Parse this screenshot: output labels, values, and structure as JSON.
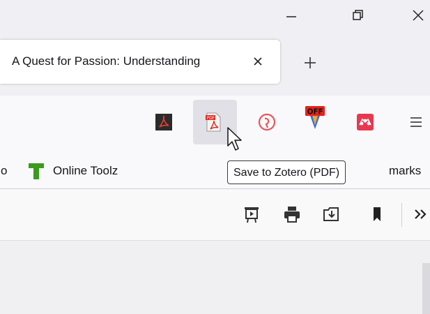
{
  "window": {
    "minimize_icon": "minimize-icon",
    "restore_icon": "restore-icon",
    "close_icon": "close-icon"
  },
  "tab": {
    "title": "A Quest for Passion: Understanding",
    "close_icon": "close-icon"
  },
  "new_tab_icon": "plus-icon",
  "toolbar": {
    "extensions": [
      {
        "name": "acrobat-icon",
        "color": "#2b2b2b"
      },
      {
        "name": "save-to-zotero-pdf-icon",
        "color": "#e1251b"
      },
      {
        "name": "grammar-extension-icon",
        "color": "#e8555c"
      },
      {
        "name": "off-extension-icon",
        "color": "#e1251b"
      },
      {
        "name": "mendeley-icon",
        "color": "#e8384f"
      }
    ],
    "menu_icon": "hamburger-menu-icon"
  },
  "bookmarks": {
    "items": [
      {
        "label": "o",
        "icon": null
      },
      {
        "label": "Online Toolz",
        "icon": "online-toolz-icon",
        "color": "#3c9a1c"
      }
    ],
    "other_label": "marks"
  },
  "tooltip": {
    "text": "Save to Zotero (PDF)"
  },
  "pdf_toolbar": {
    "icons": [
      "presentation-icon",
      "print-icon",
      "download-icon",
      "bookmark-icon",
      "more-tools-icon"
    ]
  }
}
